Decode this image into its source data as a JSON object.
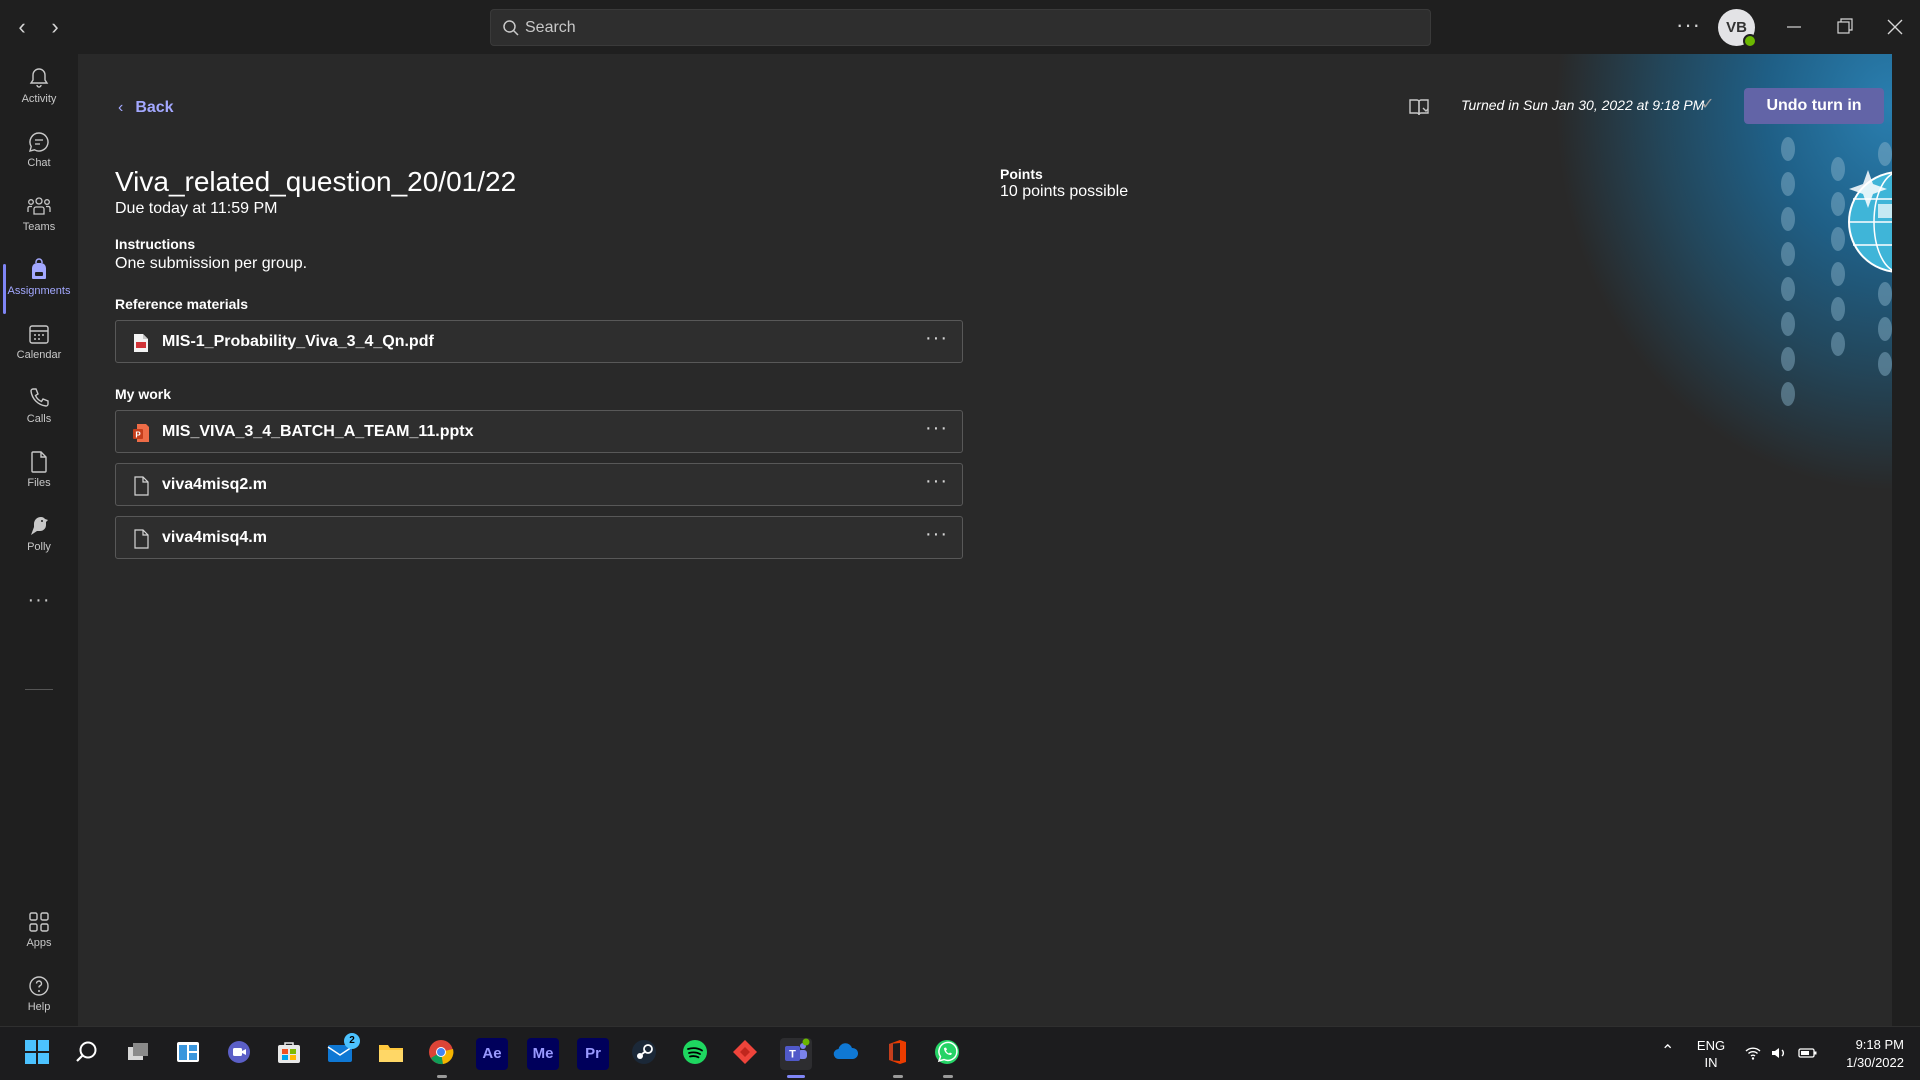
{
  "titlebar": {
    "search_placeholder": "Search",
    "avatar_initials": "VB"
  },
  "rail": {
    "items": [
      {
        "label": "Activity"
      },
      {
        "label": "Chat"
      },
      {
        "label": "Teams"
      },
      {
        "label": "Assignments"
      },
      {
        "label": "Calendar"
      },
      {
        "label": "Calls"
      },
      {
        "label": "Files"
      },
      {
        "label": "Polly"
      }
    ],
    "apps_label": "Apps",
    "help_label": "Help"
  },
  "assignment": {
    "back_label": "Back",
    "title": "Viva_related_question_20/01/22",
    "due": "Due today at 11:59 PM",
    "instructions_label": "Instructions",
    "instructions": "One submission per group.",
    "reference_label": "Reference materials",
    "reference_files": [
      {
        "name": "MIS-1_Probability_Viva_3_4_Qn.pdf"
      }
    ],
    "my_work_label": "My work",
    "my_work_files": [
      {
        "name": "MIS_VIVA_3_4_BATCH_A_TEAM_11.pptx"
      },
      {
        "name": "viva4misq2.m"
      },
      {
        "name": "viva4misq4.m"
      }
    ],
    "points_label": "Points",
    "points_value": "10 points possible",
    "turned_in": "Turned in Sun Jan 30, 2022 at 9:18 PM",
    "undo_button": "Undo turn in"
  },
  "taskbar": {
    "apps": [
      "Start",
      "Search",
      "Task View",
      "Widgets",
      "Chat",
      "Microsoft Store",
      "Mail",
      "File Explorer",
      "Chrome",
      "After Effects",
      "Media Encoder",
      "Premiere Pro",
      "Steam",
      "Spotify",
      "AnyDesk",
      "Teams",
      "OneDrive",
      "Office",
      "WhatsApp"
    ],
    "ae_label": "Ae",
    "me_label": "Me",
    "pr_label": "Pr",
    "mail_badge": "2",
    "lang_line1": "ENG",
    "lang_line2": "IN",
    "time": "9:18 PM",
    "date": "1/30/2022"
  },
  "colors": {
    "accent": "#6264a7",
    "accent_text": "#a3a8ff",
    "background": "#292929",
    "rail_bg": "#1f1f1f"
  }
}
